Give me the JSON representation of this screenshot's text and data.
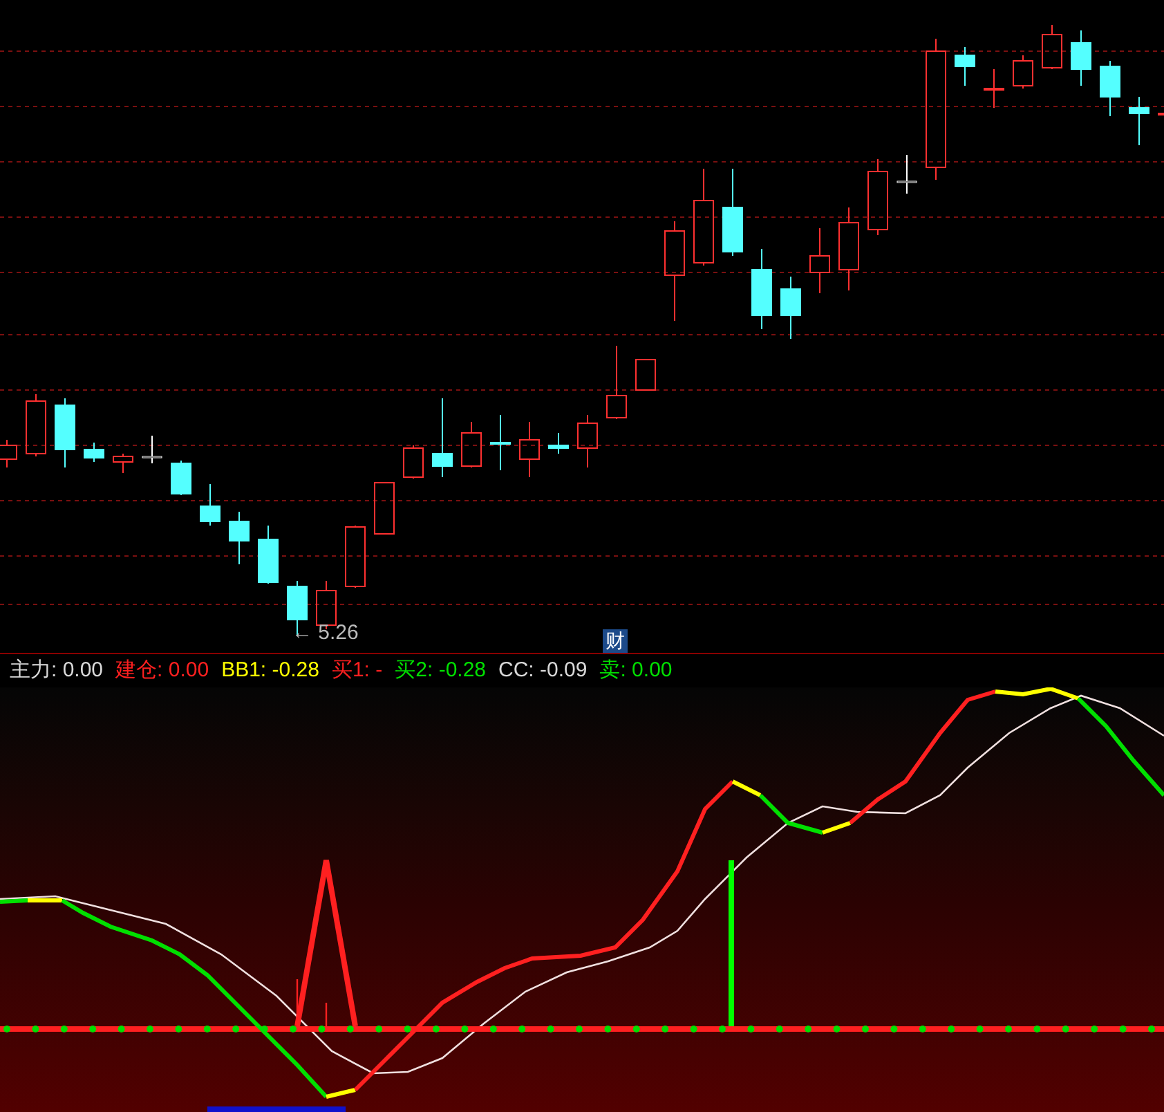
{
  "price_chart": {
    "low_marker": "← 5.26",
    "badge": "财"
  },
  "indicator_legend": [
    {
      "text": "主力: 0.00",
      "color": "#d9d9d9"
    },
    {
      "text": "建仓: 0.00",
      "color": "#ff2020"
    },
    {
      "text": "BB1: -0.28",
      "color": "#ffff00"
    },
    {
      "text": "买1: -",
      "color": "#ff2020"
    },
    {
      "text": "买2: -0.28",
      "color": "#00e000"
    },
    {
      "text": "CC: -0.09",
      "color": "#d9d9d9"
    },
    {
      "text": "卖: 0.00",
      "color": "#00e000"
    }
  ]
}
